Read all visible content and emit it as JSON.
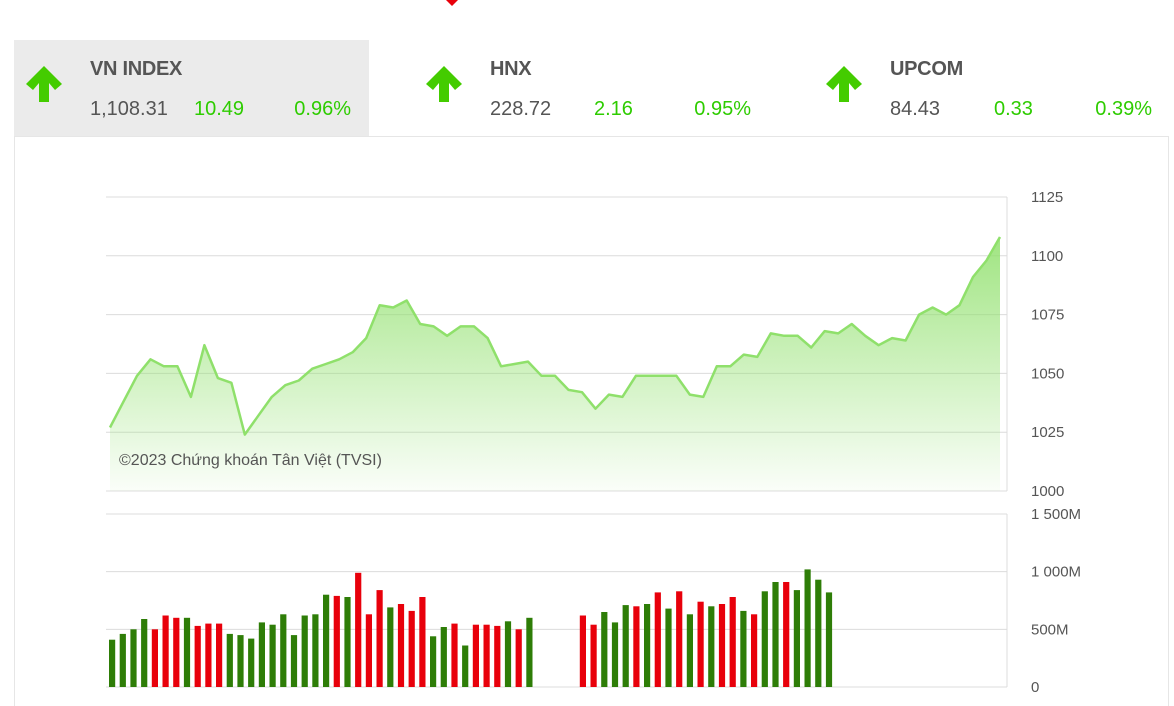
{
  "indices": [
    {
      "name": "VN INDEX",
      "price": "1,108.31",
      "change": "10.49",
      "percent": "0.96%",
      "direction": "up"
    },
    {
      "name": "HNX",
      "price": "228.72",
      "change": "2.16",
      "percent": "0.95%",
      "direction": "up"
    },
    {
      "name": "UPCOM",
      "price": "84.43",
      "change": "0.33",
      "percent": "0.39%",
      "direction": "up"
    }
  ],
  "colors": {
    "up": "#2ecc00",
    "bar_up": "#2e7d07",
    "bar_down": "#e8000b",
    "grid": "#dcdcdc",
    "line": "#8fe06b"
  },
  "chart_data": [
    {
      "type": "area",
      "ylim": [
        1000,
        1125
      ],
      "yticks": [
        "1125",
        "1100",
        "1075",
        "1050",
        "1025",
        "1000"
      ],
      "copyright": "©2023 Chứng khoán Tân Việt (TVSI)",
      "values": [
        1027,
        1038,
        1049,
        1056,
        1053,
        1053,
        1040,
        1062,
        1048,
        1046,
        1024,
        1032,
        1040,
        1045,
        1047,
        1052,
        1054,
        1056,
        1059,
        1065,
        1079,
        1078,
        1081,
        1071,
        1070,
        1066,
        1070,
        1070,
        1065,
        1053,
        1054,
        1055,
        1049,
        1049,
        1043,
        1042,
        1035,
        1041,
        1040,
        1049,
        1049,
        1049,
        1049,
        1041,
        1040,
        1053,
        1053,
        1058,
        1057,
        1067,
        1066,
        1066,
        1061,
        1068,
        1067,
        1071,
        1066,
        1062,
        1065,
        1064,
        1075,
        1078,
        1075,
        1079,
        1091,
        1098,
        1108
      ]
    },
    {
      "type": "bar",
      "ylim": [
        0,
        1500
      ],
      "yticks": [
        "1 500M",
        "1 000M",
        "500M",
        "0"
      ],
      "bars": [
        {
          "value": 410,
          "dir": "up"
        },
        {
          "value": 460,
          "dir": "up"
        },
        {
          "value": 500,
          "dir": "up"
        },
        {
          "value": 590,
          "dir": "up"
        },
        {
          "value": 500,
          "dir": "down"
        },
        {
          "value": 620,
          "dir": "down"
        },
        {
          "value": 600,
          "dir": "down"
        },
        {
          "value": 600,
          "dir": "up"
        },
        {
          "value": 530,
          "dir": "down"
        },
        {
          "value": 550,
          "dir": "down"
        },
        {
          "value": 550,
          "dir": "down"
        },
        {
          "value": 460,
          "dir": "up"
        },
        {
          "value": 450,
          "dir": "up"
        },
        {
          "value": 420,
          "dir": "up"
        },
        {
          "value": 560,
          "dir": "up"
        },
        {
          "value": 540,
          "dir": "up"
        },
        {
          "value": 630,
          "dir": "up"
        },
        {
          "value": 450,
          "dir": "up"
        },
        {
          "value": 620,
          "dir": "up"
        },
        {
          "value": 630,
          "dir": "up"
        },
        {
          "value": 800,
          "dir": "up"
        },
        {
          "value": 790,
          "dir": "down"
        },
        {
          "value": 780,
          "dir": "up"
        },
        {
          "value": 990,
          "dir": "down"
        },
        {
          "value": 630,
          "dir": "down"
        },
        {
          "value": 840,
          "dir": "down"
        },
        {
          "value": 690,
          "dir": "up"
        },
        {
          "value": 720,
          "dir": "down"
        },
        {
          "value": 660,
          "dir": "down"
        },
        {
          "value": 780,
          "dir": "down"
        },
        {
          "value": 440,
          "dir": "up"
        },
        {
          "value": 520,
          "dir": "up"
        },
        {
          "value": 550,
          "dir": "down"
        },
        {
          "value": 360,
          "dir": "up"
        },
        {
          "value": 540,
          "dir": "down"
        },
        {
          "value": 540,
          "dir": "down"
        },
        {
          "value": 530,
          "dir": "down"
        },
        {
          "value": 570,
          "dir": "up"
        },
        {
          "value": 500,
          "dir": "down"
        },
        {
          "value": 600,
          "dir": "up"
        },
        {
          "value": 0,
          "dir": "up"
        },
        {
          "value": 0,
          "dir": "up"
        },
        {
          "value": 0,
          "dir": "up"
        },
        {
          "value": 0,
          "dir": "up"
        },
        {
          "value": 620,
          "dir": "down"
        },
        {
          "value": 540,
          "dir": "down"
        },
        {
          "value": 650,
          "dir": "up"
        },
        {
          "value": 560,
          "dir": "up"
        },
        {
          "value": 710,
          "dir": "up"
        },
        {
          "value": 700,
          "dir": "down"
        },
        {
          "value": 720,
          "dir": "up"
        },
        {
          "value": 820,
          "dir": "down"
        },
        {
          "value": 680,
          "dir": "up"
        },
        {
          "value": 830,
          "dir": "down"
        },
        {
          "value": 630,
          "dir": "up"
        },
        {
          "value": 740,
          "dir": "down"
        },
        {
          "value": 700,
          "dir": "up"
        },
        {
          "value": 720,
          "dir": "down"
        },
        {
          "value": 780,
          "dir": "down"
        },
        {
          "value": 660,
          "dir": "up"
        },
        {
          "value": 630,
          "dir": "down"
        },
        {
          "value": 830,
          "dir": "up"
        },
        {
          "value": 910,
          "dir": "up"
        },
        {
          "value": 910,
          "dir": "down"
        },
        {
          "value": 840,
          "dir": "up"
        },
        {
          "value": 1020,
          "dir": "up"
        },
        {
          "value": 930,
          "dir": "up"
        },
        {
          "value": 820,
          "dir": "up"
        }
      ]
    }
  ]
}
